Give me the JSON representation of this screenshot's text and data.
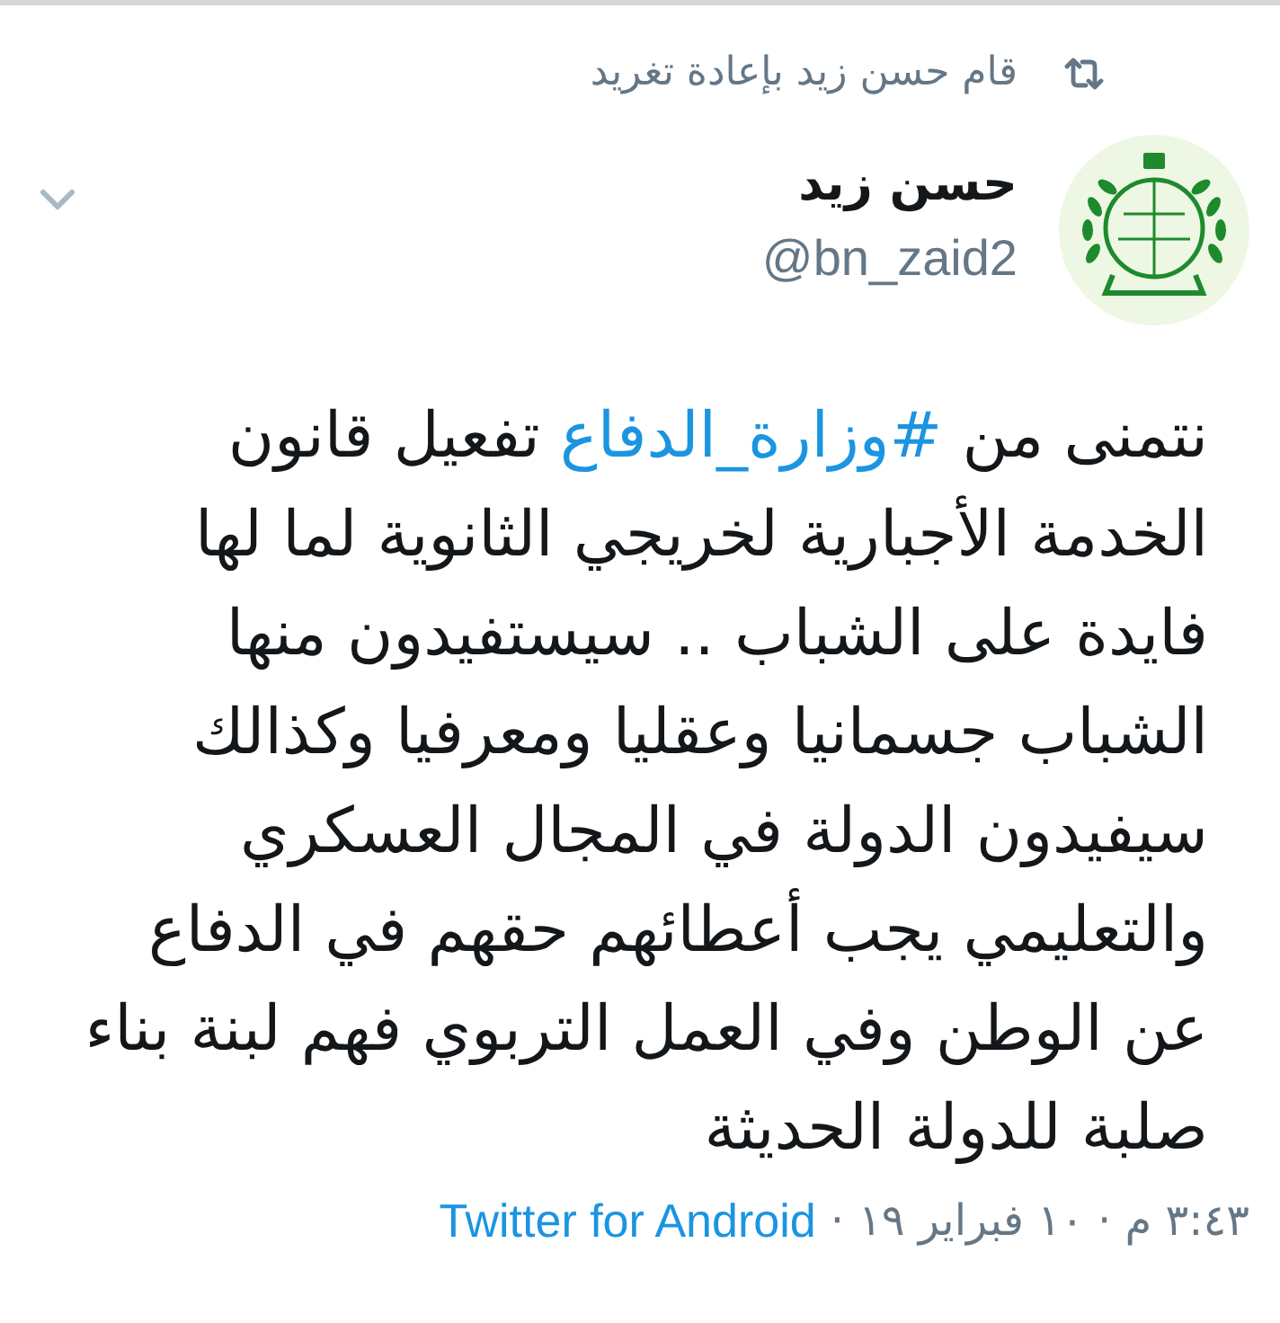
{
  "social_context": {
    "text": "قام حسن زيد بإعادة تغريد"
  },
  "author": {
    "name": "حسن زيد",
    "handle": "@bn_zaid2"
  },
  "tweet": {
    "parts": [
      {
        "kind": "text",
        "text": "نتمنى من "
      },
      {
        "kind": "hashtag",
        "text": "#وزارة_الدفاع"
      },
      {
        "kind": "text",
        "text": " تفعيل قانون الخدمة الأجبارية لخريجي الثانوية لما لها فايدة على الشباب .. سيستفيدون منها الشباب جسمانيا وعقليا ومعرفيا وكذالك سيفيدون الدولة في المجال العسكري والتعليمي يجب أعطائهم حقهم في الدفاع عن الوطن وفي العمل التربوي فهم لبنة بناء صلبة للدولة الحديثة"
      }
    ]
  },
  "footer": {
    "timestamp": "٣:٤٣ م · ١٠ فبراير ١٩",
    "separator": "·",
    "source": "Twitter for Android"
  }
}
